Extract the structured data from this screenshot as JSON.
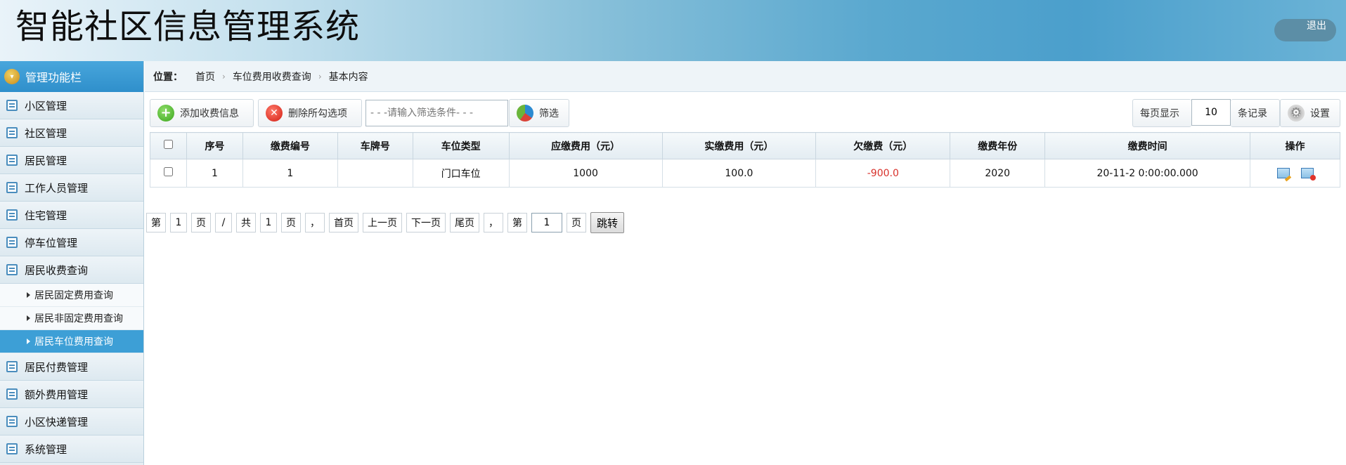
{
  "header": {
    "title": "智能社区信息管理系统",
    "logout_label": "退出"
  },
  "sidebar": {
    "heading": "管理功能栏",
    "items_top": [
      {
        "label": "小区管理"
      },
      {
        "label": "社区管理"
      },
      {
        "label": "居民管理"
      },
      {
        "label": "工作人员管理"
      },
      {
        "label": "住宅管理"
      },
      {
        "label": "停车位管理"
      },
      {
        "label": "居民收费查询"
      }
    ],
    "subitems": [
      {
        "label": "居民固定费用查询"
      },
      {
        "label": "居民非固定费用查询"
      },
      {
        "label": "居民车位费用查询"
      }
    ],
    "items_bottom": [
      {
        "label": "居民付费管理"
      },
      {
        "label": "额外费用管理"
      },
      {
        "label": "小区快递管理"
      },
      {
        "label": "系统管理"
      }
    ]
  },
  "breadcrumb": {
    "label": "位置：",
    "items": [
      "首页",
      "车位费用收费查询",
      "基本内容"
    ]
  },
  "toolbar": {
    "add_label": "添加收费信息",
    "delete_label": "删除所勾选项",
    "filter_placeholder": "- - -请输入筛选条件- - -",
    "filter_label": "筛选",
    "per_page_label": "每页显示",
    "per_page_value": "10",
    "records_label": "条记录",
    "settings_label": "设置"
  },
  "table": {
    "columns": [
      "序号",
      "缴费编号",
      "车牌号",
      "车位类型",
      "应缴费用（元）",
      "实缴费用（元）",
      "欠缴费（元）",
      "缴费年份",
      "缴费时间",
      "操作"
    ],
    "rows": [
      {
        "seq": "1",
        "payment_no": "1",
        "plate": "",
        "space_type": "门口车位",
        "due": "1000",
        "paid": "100.0",
        "owed": "-900.0",
        "year": "2020",
        "time": "20-11-2 0:00:00.000"
      }
    ]
  },
  "pager": {
    "page_prefix": "第",
    "current": "1",
    "page_suffix": "页",
    "slash": "/",
    "total_prefix": "共",
    "total": "1",
    "total_suffix": "页",
    "comma": "，",
    "first": "首页",
    "prev": "上一页",
    "next": "下一页",
    "last": "尾页",
    "jump_prefix": "第",
    "jump_value": "1",
    "jump_suffix": "页",
    "jump_label": "跳转"
  },
  "colors": {
    "accent": "#3d9fd6",
    "negative": "#d8312b"
  }
}
